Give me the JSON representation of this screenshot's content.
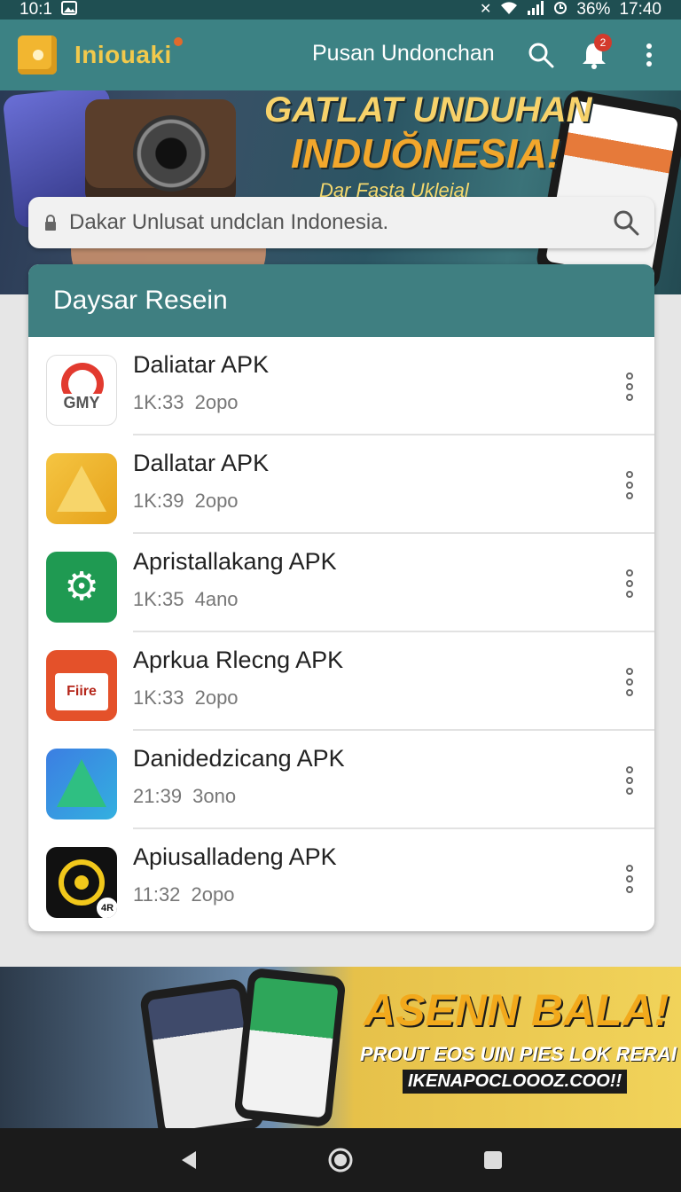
{
  "status_bar": {
    "time_left": "10:1",
    "battery": "36%",
    "time_right": "17:40"
  },
  "app_bar": {
    "brand": "Iniouaki",
    "title": "Pusan Undonchan",
    "notification_count": "2",
    "icons": [
      "search-icon",
      "bell-icon",
      "more-vert-icon"
    ]
  },
  "hero": {
    "title_line1": "GATLAT UNDUHAN",
    "title_line2": "INDUŎNESIA!",
    "subtitle": "Dar Fasta Ukleial"
  },
  "search": {
    "placeholder": "Dakar Unlusat undclan Indonesia."
  },
  "list": {
    "header": "Daysar Resein",
    "items": [
      {
        "name": "Daliatar APK",
        "meta": "1K:33 2opo",
        "icon": "gmy",
        "icon_label": "GMY"
      },
      {
        "name": "Dallatar APK",
        "meta": "1K:39 2opo",
        "icon": "yellow-triangle"
      },
      {
        "name": "Apristallakang APK",
        "meta": "1K:35 4ano",
        "icon": "green-gear"
      },
      {
        "name": "Aprkua Rlecng APK",
        "meta": "1K:33 2opo",
        "icon": "red-fire",
        "icon_label": "Fiire"
      },
      {
        "name": "Danidedzicang APK",
        "meta": "21:39 3ono",
        "icon": "blue-triangle"
      },
      {
        "name": "Apiusalladeng APK",
        "meta": "11:32 2opo",
        "icon": "black-wheel",
        "icon_label": "4R"
      }
    ]
  },
  "banner": {
    "title": "ASENN BALA!",
    "subtitle": "PROUT EOS UIN PIES LOK RERAI",
    "tagline": "IKENAPOCLOOOZ.COO!!"
  },
  "nav": {
    "icons": [
      "back-icon",
      "home-icon",
      "recents-icon"
    ]
  },
  "colors": {
    "app_bar": "#3c8284",
    "list_header": "#3f7f81",
    "brand": "#f2c94c",
    "status_bar": "#1f4f52"
  }
}
